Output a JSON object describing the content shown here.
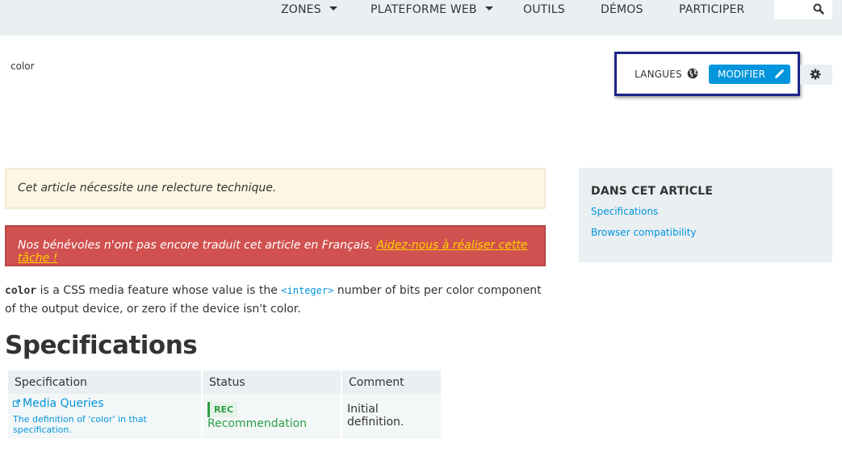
{
  "nav": {
    "items": [
      {
        "label": "ZONES",
        "dropdown": true
      },
      {
        "label": "PLATEFORME WEB",
        "dropdown": true
      },
      {
        "label": "OUTILS",
        "dropdown": false
      },
      {
        "label": "DÉMOS",
        "dropdown": false
      },
      {
        "label": "PARTICIPER",
        "dropdown": false
      }
    ],
    "search_icon": "search-icon"
  },
  "breadcrumb": "color",
  "toolbar": {
    "languages_label": "LANGUES",
    "languages_icon": "globe-icon",
    "edit_label": "MODIFIER",
    "edit_icon": "pencil-icon",
    "settings_icon": "gear-icon",
    "highlight_color": "#1c2587"
  },
  "notices": {
    "review": "Cet article nécessite une relecture technique.",
    "translate_text": "Nos bénévoles n'ont pas encore traduit cet article en Français. ",
    "translate_link": "Aidez-nous à réaliser cette tâche !"
  },
  "toc": {
    "title": "DANS CET ARTICLE",
    "links": [
      "Specifications",
      "Browser compatibility"
    ]
  },
  "intro": {
    "code": "color",
    "text1": " is a CSS media feature whose value is the ",
    "integer_link": "<integer>",
    "text2": " number of bits per color component of the output device, or zero if the device isn't color."
  },
  "specifications": {
    "heading": "Specifications",
    "columns": [
      "Specification",
      "Status",
      "Comment"
    ],
    "rows": [
      {
        "spec_name": "Media Queries",
        "spec_desc": "The definition of 'color' in that specification.",
        "status_badge": "REC",
        "status_label": "Recommendation",
        "comment": "Initial definition."
      }
    ]
  },
  "colors": {
    "accent": "#0095dd",
    "nav_bg": "#eaeff2",
    "review_bg": "#fcf6e3",
    "translate_bg": "#d0514f",
    "rec_green": "#2b9f45"
  }
}
